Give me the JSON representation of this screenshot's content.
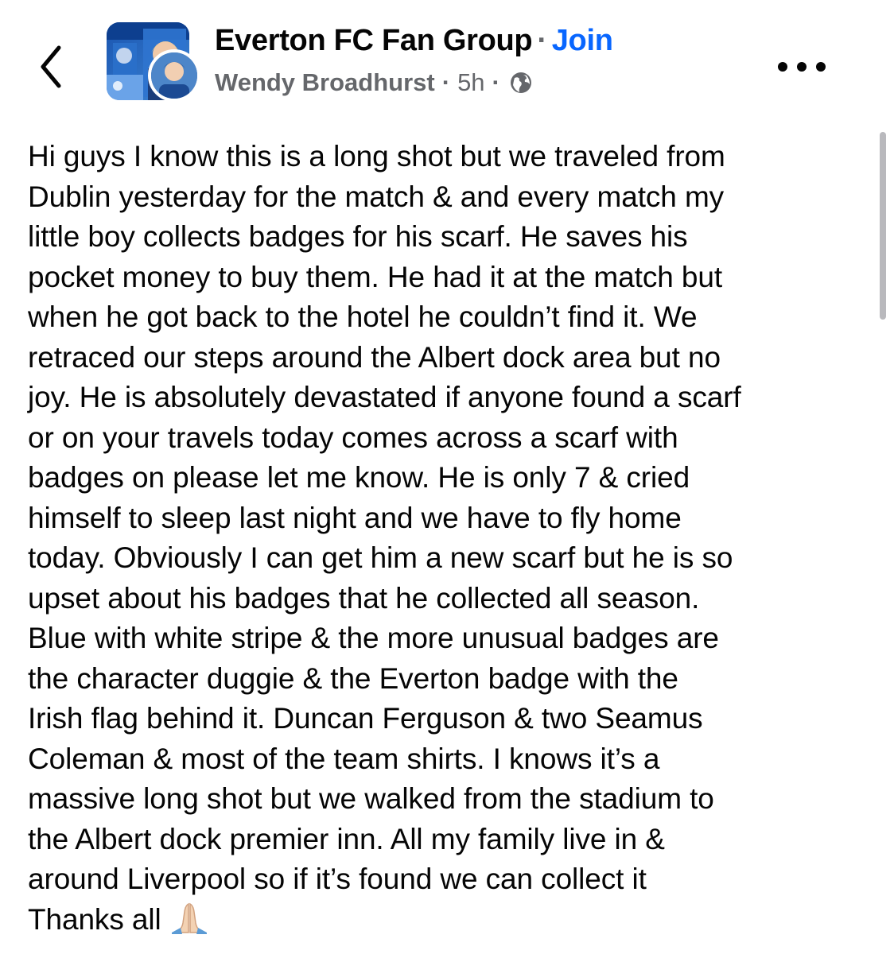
{
  "header": {
    "back_icon": "chevron-left-icon",
    "group_name": "Everton FC Fan Group",
    "separator": "·",
    "join_label": "Join",
    "author": "Wendy Broadhurst",
    "time_ago": "5h",
    "privacy_icon": "globe-icon",
    "more_icon": "more-horizontal-icon"
  },
  "post": {
    "text": "Hi guys I know this is a long shot but we traveled from\nDublin yesterday for the match & and every match my\nlittle boy collects badges for his scarf. He saves his\npocket money to buy them.  He had it at the match but\nwhen he got back to the hotel he couldn’t find it. We\nretraced our steps around the Albert dock area but no\njoy. He is absolutely devastated if anyone found a scarf\nor on your travels today comes across a scarf with\nbadges on please let me know. He is only 7 & cried\nhimself to sleep last night and we have to fly home\ntoday. Obviously I can get him a new scarf but he is so\nupset about his badges that he collected all season.\nBlue with white stripe & the more unusual badges are\nthe character duggie & the Everton badge with the\nIrish flag behind it. Duncan Ferguson & two Seamus\nColeman & most of the team shirts. I knows it’s a\nmassive long shot but we walked from the stadium to\nthe Albert dock premier inn. All my family live in &\naround Liverpool so if it’s found we can collect it\nThanks all",
    "emoji_icon": "folded-hands-icon"
  },
  "colors": {
    "link": "#0866ff",
    "secondary_text": "#65676b",
    "primary_text": "#050505",
    "group_avatar_blue": "#1f5fb5"
  }
}
